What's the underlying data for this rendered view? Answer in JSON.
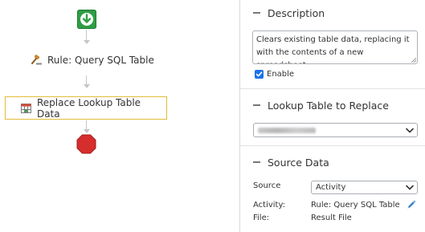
{
  "workflow": {
    "rule_node_label": "Rule: Query SQL Table",
    "step_node_label": "Replace Lookup Table Data"
  },
  "panel": {
    "description": {
      "header": "Description",
      "text": "Clears existing table data, replacing it with the contents of a new spreadsheet.",
      "enable_label": "Enable",
      "enable_checked": true
    },
    "lookup_table": {
      "header": "Lookup Table to Replace",
      "selected_value": ""
    },
    "source_data": {
      "header": "Source Data",
      "source_label": "Source",
      "source_value": "Activity",
      "activity_label": "Activity:",
      "activity_value": "Rule: Query SQL Table",
      "file_label": "File:",
      "file_value": "Result File"
    }
  },
  "colors": {
    "start_node": "#2f9e44",
    "end_node": "#d62d2d",
    "selected_border": "#e2bc3a",
    "checkbox": "#1a73e8",
    "edit_icon": "#3d85c6"
  }
}
